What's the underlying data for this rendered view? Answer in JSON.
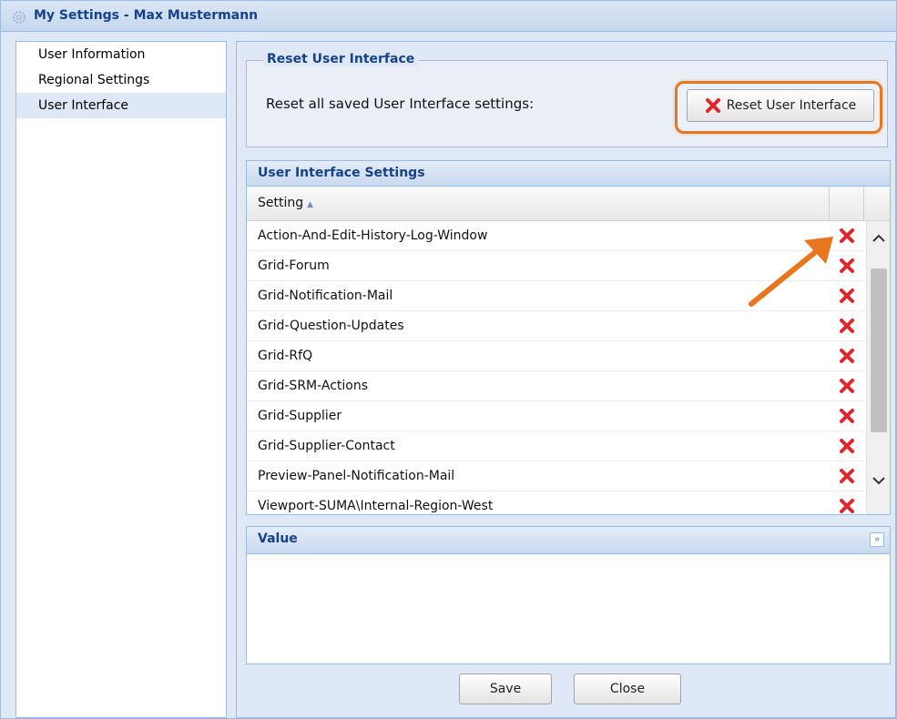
{
  "window": {
    "title": "My Settings - Max Mustermann"
  },
  "nav": {
    "items": [
      {
        "label": "User Information"
      },
      {
        "label": "Regional Settings"
      },
      {
        "label": "User Interface"
      }
    ]
  },
  "reset_section": {
    "legend": "Reset User Interface",
    "label": "Reset all saved User Interface settings:",
    "button_label": "Reset User Interface"
  },
  "grid": {
    "title": "User Interface Settings",
    "column_setting": "Setting",
    "rows": [
      "Action-And-Edit-History-Log-Window",
      "Grid-Forum",
      "Grid-Notification-Mail",
      "Grid-Question-Updates",
      "Grid-RfQ",
      "Grid-SRM-Actions",
      "Grid-Supplier",
      "Grid-Supplier-Contact",
      "Preview-Panel-Notification-Mail",
      "Viewport-SUMA\\Internal-Region-West"
    ]
  },
  "value_panel": {
    "title": "Value"
  },
  "footer": {
    "save_label": "Save",
    "close_label": "Close"
  },
  "colors": {
    "accent": "#15428b",
    "highlight": "#e8761e",
    "delete_red": "#e0262b"
  },
  "icons": {
    "title": "gear-icon",
    "delete": "red-x-icon",
    "sort": "sort-ascending-icon",
    "collapse": "double-chevron-down-icon"
  }
}
